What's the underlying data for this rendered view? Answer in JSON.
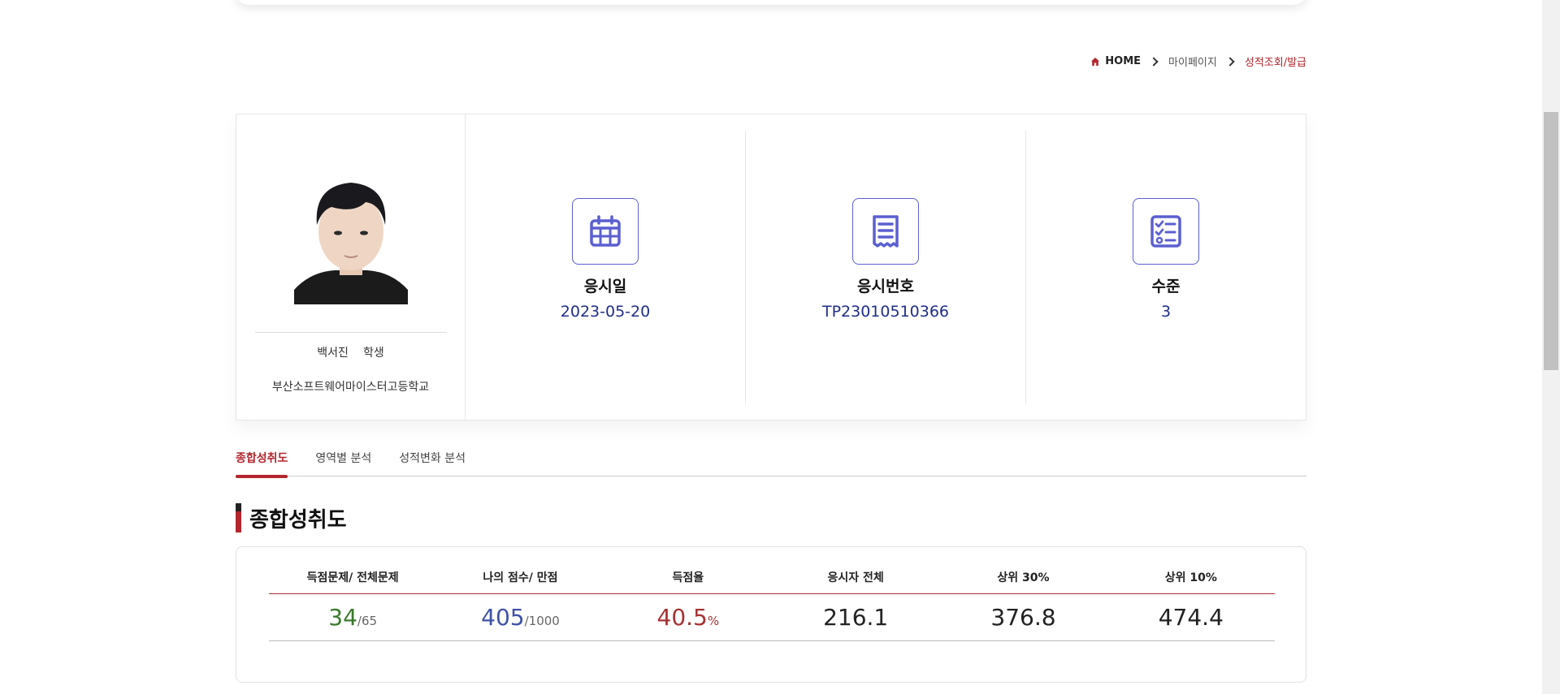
{
  "breadcrumb": {
    "home": "HOME",
    "mid": "마이페이지",
    "current": "성적조회/발급"
  },
  "profile": {
    "name": "백서진",
    "role": "학생",
    "school": "부산소프트웨어마이스터고등학교"
  },
  "stats": [
    {
      "label": "응시일",
      "value": "2023-05-20",
      "icon": "calendar-icon"
    },
    {
      "label": "응시번호",
      "value": "TP23010510366",
      "icon": "receipt-icon"
    },
    {
      "label": "수준",
      "value": "3",
      "icon": "checklist-icon"
    }
  ],
  "tabs": [
    "종합성취도",
    "영역별 분석",
    "성적변화 분석"
  ],
  "section_title": "종합성취도",
  "score_table": {
    "headers": [
      "득점문제/ 전체문제",
      "나의 점수/ 만점",
      "득점율",
      "응시자 전체",
      "상위 30%",
      "상위 10%"
    ],
    "correct": "34",
    "total": "/65",
    "score": "405",
    "max": "/1000",
    "rate": "40.5",
    "rate_unit": "%",
    "all": "216.1",
    "top30": "376.8",
    "top10": "474.4"
  },
  "colors": {
    "accent": "#b3262d",
    "icon": "#5b5fd1",
    "value": "#1f2e8a",
    "green": "#3a7a2c",
    "blue": "#3f52a8"
  }
}
